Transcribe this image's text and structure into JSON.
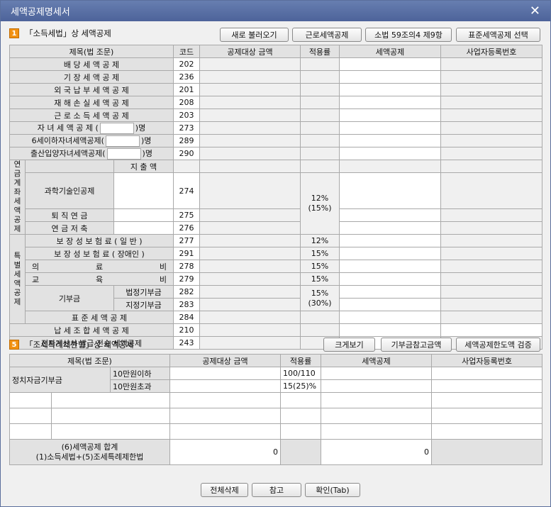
{
  "window": {
    "title": "세액공제명세서"
  },
  "section1": {
    "num": "1",
    "title": "「소득세법」상 세액공제",
    "buttons": {
      "reload": "새로 불러오기",
      "earned": "근로세액공제",
      "art59": "소법 59조의4 제9항",
      "std": "표준세액공제 선택"
    },
    "headers": {
      "item": "제목(법 조문)",
      "code": "코드",
      "base": "공제대상 금액",
      "rate": "적용률",
      "credit": "세액공제",
      "bizno": "사업자등록번호"
    },
    "rows": {
      "r202": {
        "label": "배 당 세 액 공 제",
        "code": "202"
      },
      "r236": {
        "label": "기 장 세 액 공 제",
        "code": "236"
      },
      "r201": {
        "label": "외 국 납 부 세 액 공 제",
        "code": "201"
      },
      "r208": {
        "label": "재 해 손 실 세 액 공 제",
        "code": "208"
      },
      "r203": {
        "label": "근 로 소 득 세 액 공 제",
        "code": "203"
      },
      "r273": {
        "label_a": "자 녀 세 액 공 제 (",
        "label_b": ")명",
        "code": "273"
      },
      "r289": {
        "label_a": "6세이하자녀세액공제(",
        "label_b": ")명",
        "code": "289"
      },
      "r290": {
        "label_a": "출산입양자녀세액공제(",
        "label_b": ")명",
        "code": "290"
      },
      "pension": {
        "group": "연금계좌세액공제",
        "spend": "지 출 액",
        "r274": {
          "label": "과학기술인공제",
          "code": "274"
        },
        "r275": {
          "label": "퇴 직 연 금",
          "code": "275"
        },
        "r276": {
          "label": "연 금 저 축",
          "code": "276"
        },
        "rate": "12%",
        "rate2": "(15%)"
      },
      "special": {
        "group": "특별세액공제",
        "r277": {
          "label": "보 장 성 보 험 료 ( 일 반 )",
          "code": "277",
          "rate": "12%"
        },
        "r291": {
          "label": "보 장 성 보 험 료 ( 장애인 )",
          "code": "291",
          "rate": "15%"
        },
        "r278": {
          "label_a": "의",
          "label_b": "료",
          "label_c": "비",
          "code": "278",
          "rate": "15%"
        },
        "r279": {
          "label_a": "교",
          "label_b": "육",
          "label_c": "비",
          "code": "279",
          "rate": "15%"
        },
        "donation": {
          "label": "기부금",
          "r282": {
            "label": "법정기부금",
            "code": "282"
          },
          "r283": {
            "label": "지정기부금",
            "code": "283"
          },
          "rate": "15%",
          "rate2": "(30%)"
        },
        "r284": {
          "label": "표 준 세 액 공 제",
          "code": "284"
        }
      },
      "r210": {
        "label": "납 세 조 합 세 액 공 제",
        "code": "210"
      },
      "r243": {
        "label": "전자계산서 발급 전송 세액공제",
        "code": "243"
      }
    }
  },
  "section5": {
    "num": "5",
    "title": "「조세특례제한법」상 세액공제",
    "buttons": {
      "zoom": "크게보기",
      "donation": "기부금참고금액",
      "limit": "세액공제한도액 검증"
    },
    "headers": {
      "item": "제목(법 조문)",
      "base": "공제대상 금액",
      "rate": "적용률",
      "credit": "세액공제",
      "bizno": "사업자등록번호"
    },
    "political": {
      "label": "정치자금기부금",
      "sub1": "10만원이하",
      "rate1": "100/110",
      "sub2": "10만원초과",
      "rate2": "15(25)%"
    },
    "total": {
      "line1": "(6)세액공제 합계",
      "line2": "(1)소득세법+(5)조세특례제한법",
      "base": "0",
      "credit": "0"
    }
  },
  "footer": {
    "delete_all": "전체삭제",
    "ref": "참고",
    "confirm": "확인(Tab)"
  }
}
